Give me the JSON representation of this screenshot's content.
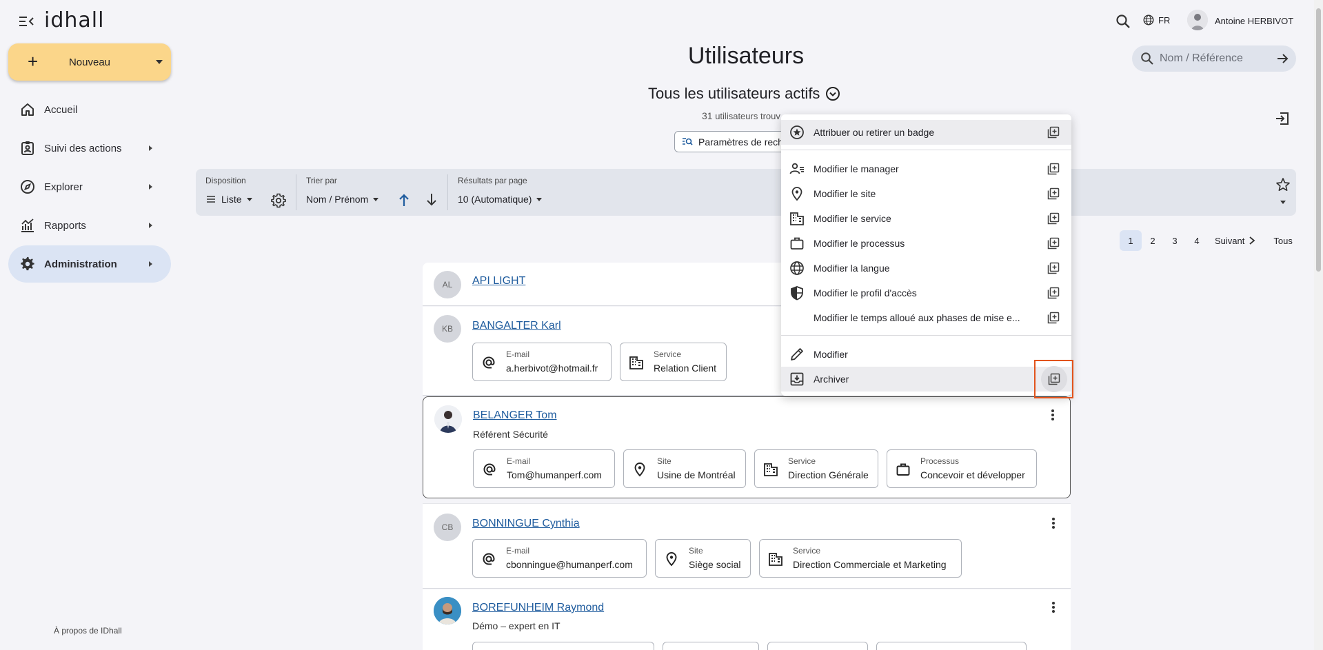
{
  "app": {
    "logo": "idhall"
  },
  "sidebar": {
    "new_label": "Nouveau",
    "items": [
      {
        "label": "Accueil",
        "icon": "home-icon"
      },
      {
        "label": "Suivi des actions",
        "icon": "clipboard-user-icon"
      },
      {
        "label": "Explorer",
        "icon": "compass-icon"
      },
      {
        "label": "Rapports",
        "icon": "chart-icon"
      },
      {
        "label": "Administration",
        "icon": "gear-icon",
        "active": true
      }
    ],
    "about": "À propos de IDhall"
  },
  "header": {
    "lang": "FR",
    "user_name": "Antoine HERBIVOT",
    "search_placeholder": "Nom / Référence"
  },
  "main": {
    "title": "Utilisateurs",
    "filter_title": "Tous les utilisateurs actifs",
    "count_number": "31",
    "count_text": "utilisateurs trouv",
    "search_params_label": "Paramètres de rech"
  },
  "toolbar": {
    "disposition_label": "Disposition",
    "disposition_value": "Liste",
    "sort_label": "Trier par",
    "sort_value": "Nom / Prénom",
    "results_label": "Résultats par page",
    "results_value": "10 (Automatique)"
  },
  "pagination": {
    "pages": [
      "1",
      "2",
      "3",
      "4"
    ],
    "current": "1",
    "next": "Suivant",
    "all": "Tous"
  },
  "users": [
    {
      "initials": "AL",
      "name": "API LIGHT"
    },
    {
      "initials": "KB",
      "name": "BANGALTER Karl",
      "chips": [
        {
          "label": "E-mail",
          "value": "a.herbivot@hotmail.fr",
          "icon": "at-icon"
        },
        {
          "label": "Service",
          "value": "Relation Client",
          "icon": "building-icon"
        }
      ]
    },
    {
      "name": "BELANGER Tom",
      "subtitle": "Référent Sécurité",
      "chips": [
        {
          "label": "E-mail",
          "value": "Tom@humanperf.com",
          "icon": "at-icon"
        },
        {
          "label": "Site",
          "value": "Usine de Montréal",
          "icon": "pin-icon"
        },
        {
          "label": "Service",
          "value": "Direction Générale",
          "icon": "building-icon"
        },
        {
          "label": "Processus",
          "value": "Concevoir et développer",
          "icon": "briefcase-icon"
        }
      ]
    },
    {
      "initials": "CB",
      "name": "BONNINGUE Cynthia",
      "chips": [
        {
          "label": "E-mail",
          "value": "cbonningue@humanperf.com",
          "icon": "at-icon"
        },
        {
          "label": "Site",
          "value": "Siège social",
          "icon": "pin-icon"
        },
        {
          "label": "Service",
          "value": "Direction Commerciale et Marketing",
          "icon": "building-icon"
        }
      ]
    },
    {
      "name": "BOREFUNHEIM Raymond",
      "subtitle": "Démo – expert en IT"
    }
  ],
  "context_menu": {
    "items": [
      {
        "label": "Attribuer ou retirer un badge",
        "icon": "badge-star-icon"
      },
      {
        "label": "Modifier le manager",
        "icon": "manager-icon"
      },
      {
        "label": "Modifier le site",
        "icon": "pin-icon"
      },
      {
        "label": "Modifier le service",
        "icon": "building-icon"
      },
      {
        "label": "Modifier le processus",
        "icon": "briefcase-icon"
      },
      {
        "label": "Modifier la langue",
        "icon": "globe-icon"
      },
      {
        "label": "Modifier le profil d'accès",
        "icon": "shield-icon"
      },
      {
        "label": "Modifier le temps alloué aux phases de mise e...",
        "icon": ""
      },
      {
        "label": "Modifier",
        "icon": "pencil-icon"
      },
      {
        "label": "Archiver",
        "icon": "archive-icon"
      }
    ]
  },
  "colors": {
    "accent_yellow": "#fbd68a",
    "active_nav": "#dbe4f4",
    "link": "#1f5c9e",
    "highlight_box": "#e2531b"
  }
}
